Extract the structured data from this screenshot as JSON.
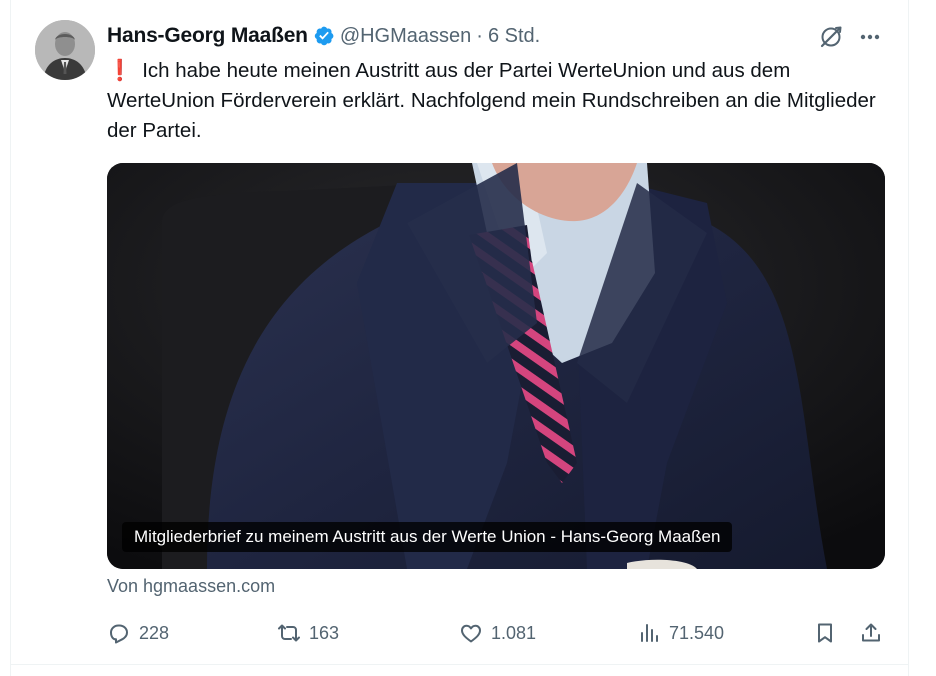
{
  "tweet": {
    "author_name": "Hans-Georg Maaßen",
    "handle": "@HGMaassen",
    "separator": "·",
    "time": "6 Std.",
    "verified_color": "#1d9bf0",
    "text_icon": "❗",
    "text": "Ich habe heute meinen Austritt aus der Partei WerteUnion und aus dem WerteUnion Förderverein erklärt. Nachfolgend mein Rundschreiben an die Mitglieder der Partei."
  },
  "link_card": {
    "caption": "Mitgliederbrief zu meinem Austritt aus der Werte Union - Hans-Georg Maaßen",
    "source": "Von hgmaassen.com",
    "tie_colors": [
      "#d4457e",
      "#1a1d33"
    ]
  },
  "actions": {
    "replies": "228",
    "reposts": "163",
    "likes": "1.081",
    "views": "71.540"
  },
  "icons": {
    "header": [
      "grok-icon",
      "more-icon",
      "verified-badge-icon"
    ],
    "actions": [
      "reply-icon",
      "repost-icon",
      "like-icon",
      "views-icon",
      "bookmark-icon",
      "share-icon"
    ]
  }
}
